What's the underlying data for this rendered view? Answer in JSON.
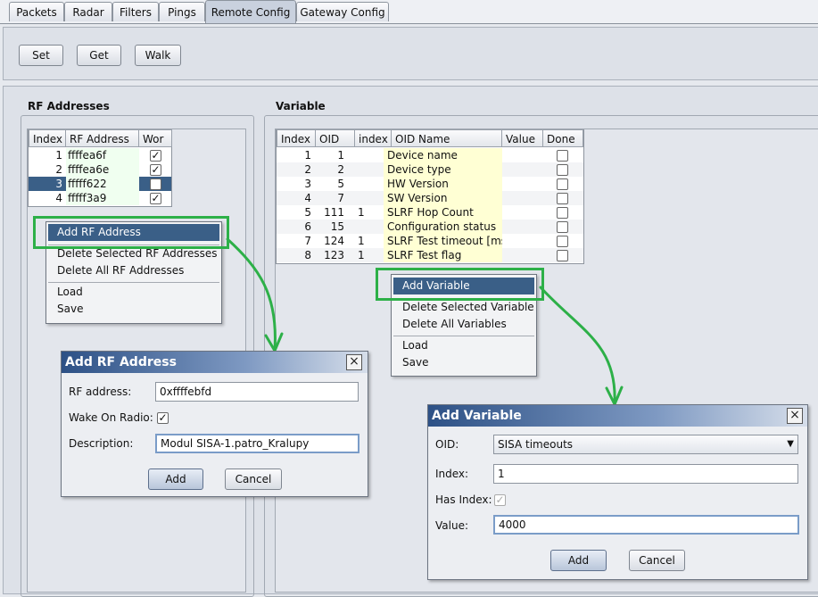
{
  "tabs": [
    "Packets",
    "Radar",
    "Filters",
    "Pings",
    "Remote Config",
    "Gateway Config"
  ],
  "active_tab": "Remote Config",
  "toolbar": {
    "set": "Set",
    "get": "Get",
    "walk": "Walk"
  },
  "rf": {
    "title": "RF Addresses",
    "columns": [
      "Index",
      "RF Address",
      "Wor"
    ],
    "rows": [
      {
        "index": "1",
        "address": "ffffea6f",
        "wor": true
      },
      {
        "index": "2",
        "address": "ffffea6e",
        "wor": true
      },
      {
        "index": "3",
        "address": "fffff622",
        "wor": false
      },
      {
        "index": "4",
        "address": "fffff3a9",
        "wor": true
      }
    ],
    "selected_row": 2
  },
  "rf_menu": [
    "Add RF Address",
    "Delete Selected RF Addresses",
    "Delete All RF Addresses",
    "Load",
    "Save"
  ],
  "var": {
    "title": "Variable",
    "columns": [
      "Index",
      "OID",
      "index",
      "OID Name",
      "Value",
      "Done"
    ],
    "rows": [
      {
        "index": "1",
        "oid": "1",
        "idx": "",
        "name": "Device name",
        "value": "",
        "done": false
      },
      {
        "index": "2",
        "oid": "2",
        "idx": "",
        "name": "Device type",
        "value": "",
        "done": false
      },
      {
        "index": "3",
        "oid": "5",
        "idx": "",
        "name": "HW Version",
        "value": "",
        "done": false
      },
      {
        "index": "4",
        "oid": "7",
        "idx": "",
        "name": "SW Version",
        "value": "",
        "done": false
      },
      {
        "index": "5",
        "oid": "111",
        "idx": "1",
        "name": "SLRF Hop Count",
        "value": "",
        "done": false
      },
      {
        "index": "6",
        "oid": "15",
        "idx": "",
        "name": "Configuration status",
        "value": "",
        "done": false
      },
      {
        "index": "7",
        "oid": "124",
        "idx": "1",
        "name": "SLRF Test timeout [ms]",
        "value": "",
        "done": false
      },
      {
        "index": "8",
        "oid": "123",
        "idx": "1",
        "name": "SLRF Test flag",
        "value": "",
        "done": false
      }
    ]
  },
  "var_menu": [
    "Add Variable",
    "Delete Selected Variable",
    "Delete All Variables",
    "Load",
    "Save"
  ],
  "rf_dialog": {
    "title": "Add RF Address",
    "close": "×",
    "rf_label": "RF address:",
    "rf_value": "0xffffebfd",
    "wor_label": "Wake On Radio:",
    "wor_checked": true,
    "desc_label": "Description:",
    "desc_value": "Modul SISA-1.patro_Kralupy",
    "add": "Add",
    "cancel": "Cancel"
  },
  "var_dialog": {
    "title": "Add Variable",
    "close": "×",
    "oid_label": "OID:",
    "oid_value": "SISA timeouts",
    "index_label": "Index:",
    "index_value": "1",
    "hasindex_label": "Has Index:",
    "hasindex_checked": true,
    "value_label": "Value:",
    "value_value": "4000",
    "add": "Add",
    "cancel": "Cancel"
  },
  "colors": {
    "highlight": "#2db048",
    "selection": "#3a5f87",
    "oid_name_bg": "#ffffd4",
    "rf_addr_bg": "#f0fff0"
  }
}
